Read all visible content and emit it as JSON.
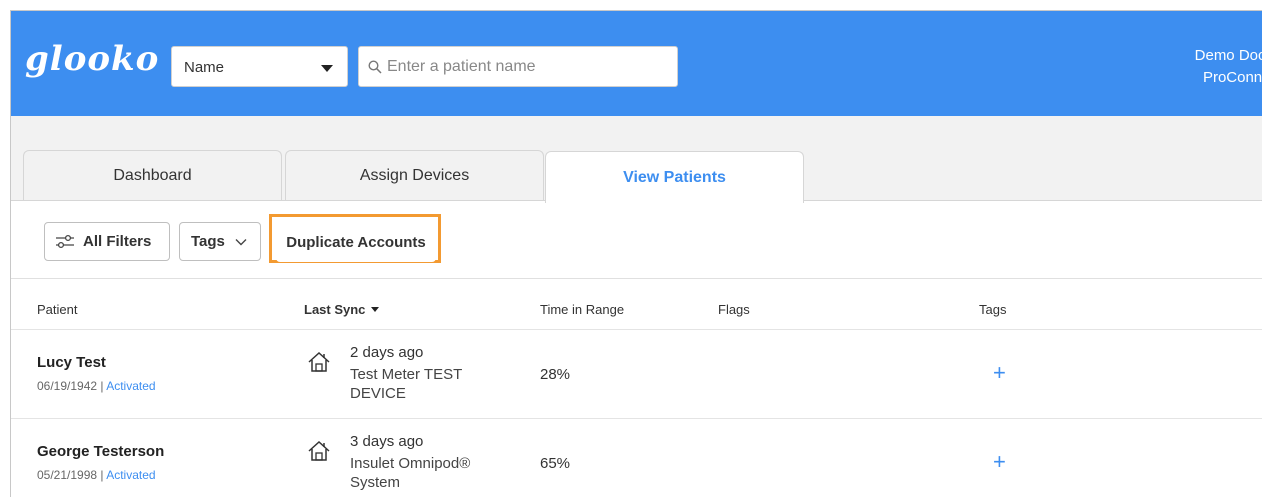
{
  "header": {
    "logo": "glooko",
    "search_type": "Name",
    "search_placeholder": "Enter a patient name",
    "user_name": "Demo Doctor",
    "user_org": "ProConnect Clinic"
  },
  "tabs": [
    {
      "label": "Dashboard",
      "active": false
    },
    {
      "label": "Assign Devices",
      "active": false
    },
    {
      "label": "View Patients",
      "active": true
    }
  ],
  "toolbar": {
    "filters_label": "All Filters",
    "tags_label": "Tags",
    "duplicate_label": "Duplicate Accounts"
  },
  "table": {
    "headers": [
      "Patient",
      "Last Sync",
      "Time in Range",
      "Flags",
      "Tags"
    ],
    "rows": [
      {
        "name": "Lucy Test",
        "dob": "06/19/1942",
        "separator": " | ",
        "status": "Activated",
        "sync_when": "2 days ago",
        "sync_device": "Test Meter TEST DEVICE",
        "time_in_range": "28%",
        "tags_action": "+"
      },
      {
        "name": "George Testerson",
        "dob": "05/21/1998",
        "separator": " | ",
        "status": "Activated",
        "sync_when": "3 days ago",
        "sync_device": "Insulet Omnipod® System",
        "time_in_range": "65%",
        "tags_action": "+"
      }
    ]
  },
  "colors": {
    "brand": "#3d8ef0",
    "highlight": "#f39a31"
  }
}
